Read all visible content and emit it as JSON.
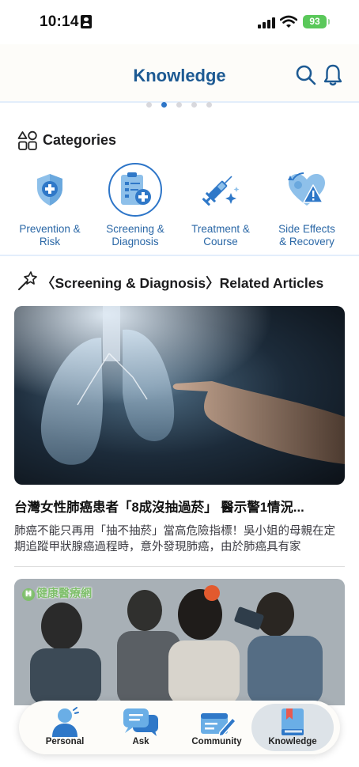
{
  "status_bar": {
    "time": "10:14",
    "battery": "93"
  },
  "header": {
    "title": "Knowledge"
  },
  "carousel": {
    "dot_count": 5,
    "active_index": 1
  },
  "categories": {
    "title": "Categories",
    "items": [
      {
        "label_line1": "Prevention &",
        "label_line2": "Risk",
        "icon": "shield-plus-icon",
        "selected": false
      },
      {
        "label_line1": "Screening &",
        "label_line2": "Diagnosis",
        "icon": "clipboard-medical-icon",
        "selected": true
      },
      {
        "label_line1": "Treatment &",
        "label_line2": "Course",
        "icon": "syringe-icon",
        "selected": false
      },
      {
        "label_line1": "Side Effects",
        "label_line2": "& Recovery",
        "icon": "heart-alert-icon",
        "selected": false
      }
    ]
  },
  "related": {
    "title": "〈Screening & Diagnosis〉Related Articles",
    "articles": [
      {
        "title": "台灣女性肺癌患者「8成沒抽過菸」 醫示警1情況...",
        "summary": "肺癌不能只再用「抽不抽菸」當高危險指標！吳小姐的母親在定期追蹤甲狀腺癌過程時，意外發現肺癌，由於肺癌具有家"
      },
      {
        "watermark": "健康醫療網"
      }
    ]
  },
  "tabbar": {
    "items": [
      {
        "label": "Personal",
        "icon": "person-icon",
        "active": false
      },
      {
        "label": "Ask",
        "icon": "chat-bubbles-icon",
        "active": false
      },
      {
        "label": "Community",
        "icon": "community-edit-icon",
        "active": false
      },
      {
        "label": "Knowledge",
        "icon": "book-icon",
        "active": true
      }
    ]
  },
  "colors": {
    "accent": "#2d75c8",
    "title_blue": "#1d5a93",
    "category_label": "#2a67a6",
    "icon_light_blue": "#8ec0ea",
    "battery_green": "#5ac85a"
  }
}
